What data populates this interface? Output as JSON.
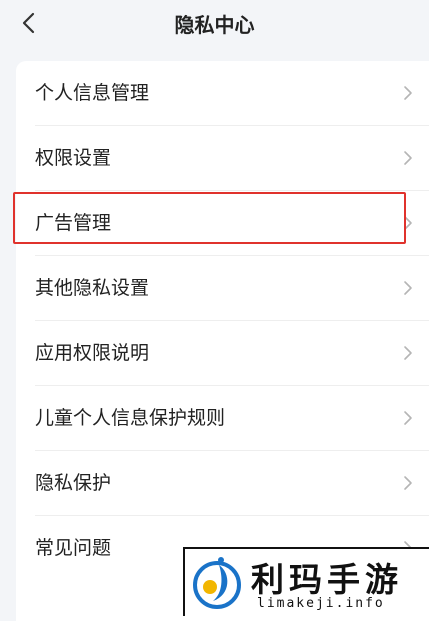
{
  "header": {
    "title": "隐私中心",
    "back_icon": "chevron-left-icon"
  },
  "menu": {
    "items": [
      {
        "label": "个人信息管理"
      },
      {
        "label": "权限设置"
      },
      {
        "label": "广告管理",
        "highlighted": true
      },
      {
        "label": "其他隐私设置"
      },
      {
        "label": "应用权限说明"
      },
      {
        "label": "儿童个人信息保护规则"
      },
      {
        "label": "隐私保护"
      },
      {
        "label": "常见问题"
      }
    ],
    "chevron_icon": "chevron-right-icon"
  },
  "highlight_color": "#e0322c",
  "watermark": {
    "text": "利玛手游",
    "domain": "limakeji.info"
  }
}
